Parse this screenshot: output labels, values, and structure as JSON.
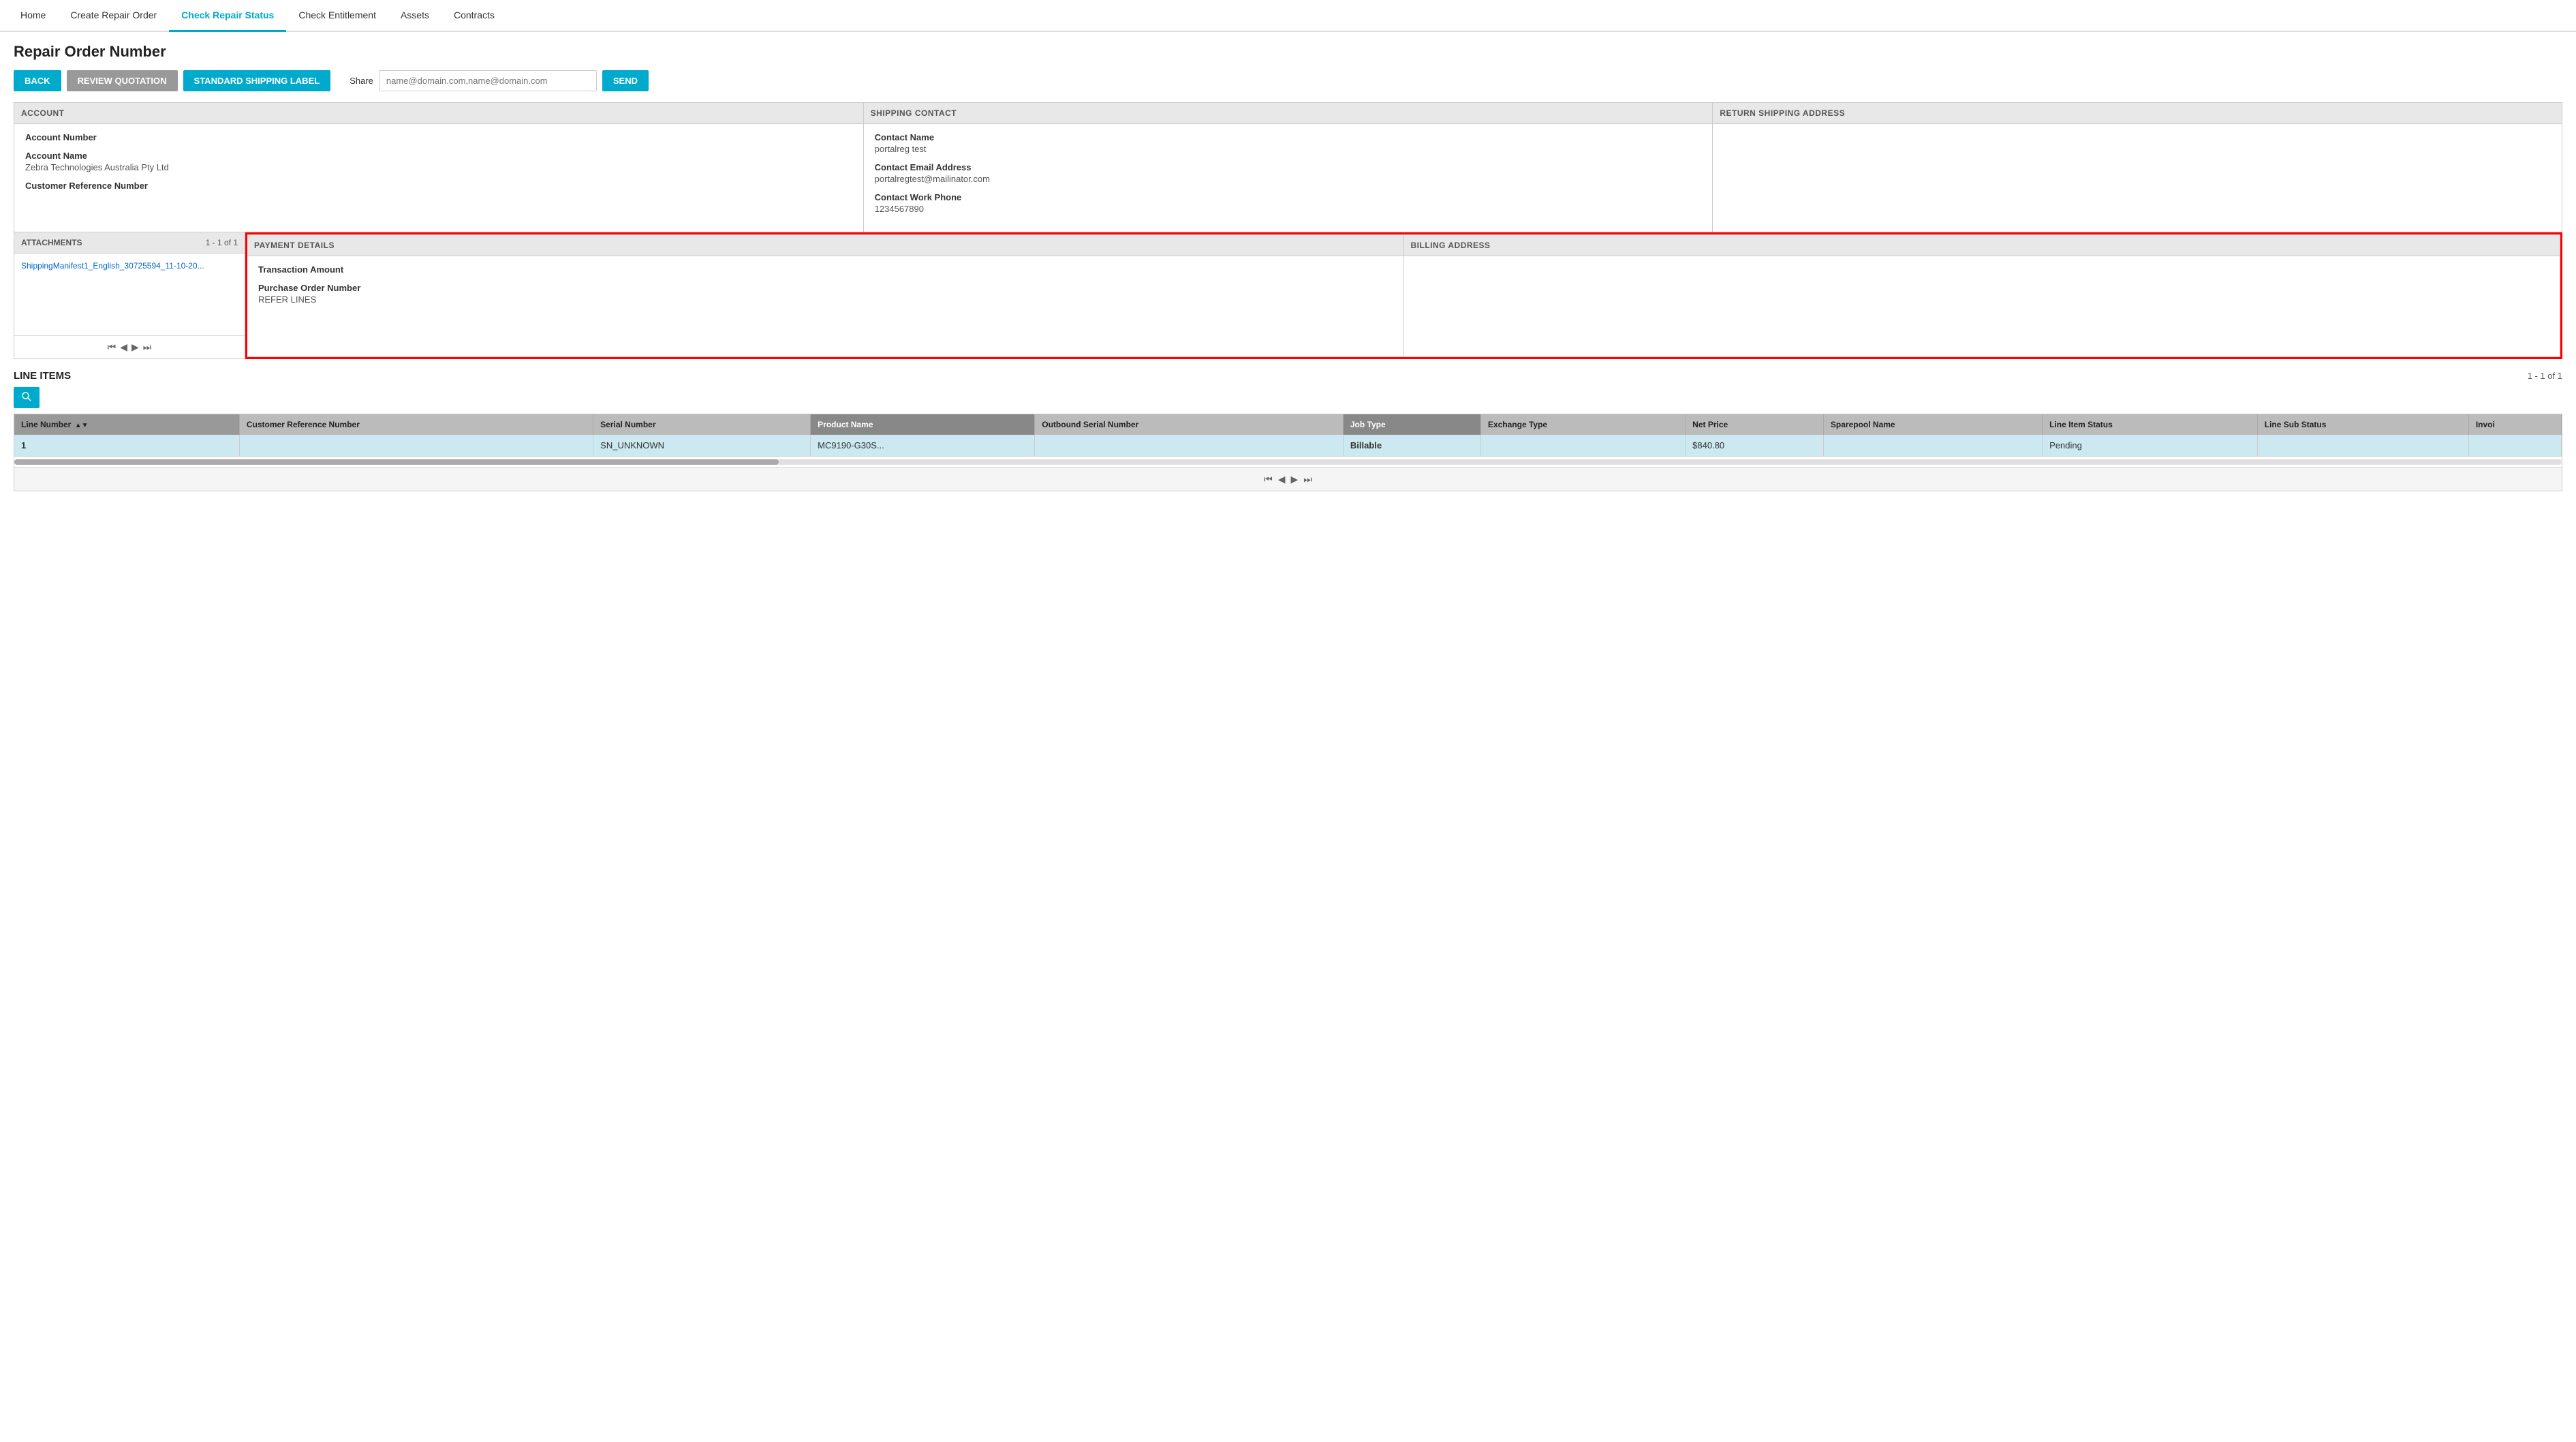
{
  "nav": {
    "items": [
      {
        "label": "Home",
        "active": false
      },
      {
        "label": "Create Repair Order",
        "active": false
      },
      {
        "label": "Check Repair Status",
        "active": true
      },
      {
        "label": "Check Entitlement",
        "active": false
      },
      {
        "label": "Assets",
        "active": false
      },
      {
        "label": "Contracts",
        "active": false
      }
    ]
  },
  "page": {
    "title": "Repair Order Number",
    "toolbar": {
      "back_label": "BACK",
      "review_label": "REVIEW QUOTATION",
      "shipping_label": "STANDARD SHIPPING LABEL",
      "share_label": "Share",
      "share_placeholder": "name@domain.com,name@domain.com",
      "send_label": "SEND"
    }
  },
  "account": {
    "header": "ACCOUNT",
    "fields": [
      {
        "label": "Account Number",
        "value": ""
      },
      {
        "label": "Account Name",
        "value": "Zebra Technologies Australia Pty Ltd"
      },
      {
        "label": "Customer Reference Number",
        "value": ""
      }
    ]
  },
  "shipping_contact": {
    "header": "SHIPPING CONTACT",
    "fields": [
      {
        "label": "Contact Name",
        "value": "portalreg test"
      },
      {
        "label": "Contact Email Address",
        "value": "portalregtest@mailinator.com"
      },
      {
        "label": "Contact Work Phone",
        "value": "1234567890"
      }
    ]
  },
  "return_shipping": {
    "header": "RETURN SHIPPING ADDRESS"
  },
  "attachments": {
    "header": "ATTACHMENTS",
    "count": "1 - 1 of 1",
    "link_text": "ShippingManifest1_English_30725594_11-10-20...",
    "pagination": {
      "first": "⏮",
      "prev": "◀",
      "next": "▶",
      "last": "⏭"
    }
  },
  "payment_details": {
    "header": "PAYMENT DETAILS",
    "fields": [
      {
        "label": "Transaction Amount",
        "value": ""
      },
      {
        "label": "Purchase Order Number",
        "value": "REFER LINES"
      }
    ]
  },
  "billing_address": {
    "header": "BILLING ADDRESS"
  },
  "line_items": {
    "title": "LINE ITEMS",
    "count": "1 - 1 of 1",
    "columns": [
      {
        "label": "Line Number",
        "sorted": true
      },
      {
        "label": "Customer Reference Number",
        "sorted": false
      },
      {
        "label": "Serial Number",
        "sorted": false
      },
      {
        "label": "Product Name",
        "sorted": false,
        "highlighted": true
      },
      {
        "label": "Outbound Serial Number",
        "sorted": false
      },
      {
        "label": "Job Type",
        "sorted": false,
        "highlighted": true
      },
      {
        "label": "Exchange Type",
        "sorted": false
      },
      {
        "label": "Net Price",
        "sorted": false
      },
      {
        "label": "Sparepool Name",
        "sorted": false
      },
      {
        "label": "Line Item Status",
        "sorted": false
      },
      {
        "label": "Line Sub Status",
        "sorted": false
      },
      {
        "label": "Invoi",
        "sorted": false
      }
    ],
    "rows": [
      {
        "line_number": "1",
        "customer_ref": "",
        "serial_number": "SN_UNKNOWN",
        "product_name": "MC9190-G30S...",
        "outbound_serial": "",
        "job_type": "Billable",
        "exchange_type": "",
        "net_price": "$840.80",
        "sparepool": "",
        "line_item_status": "Pending",
        "line_sub_status": "",
        "invoi": ""
      }
    ],
    "pagination": {
      "first": "⏮",
      "prev": "◀",
      "next": "▶",
      "last": "⏭"
    }
  }
}
